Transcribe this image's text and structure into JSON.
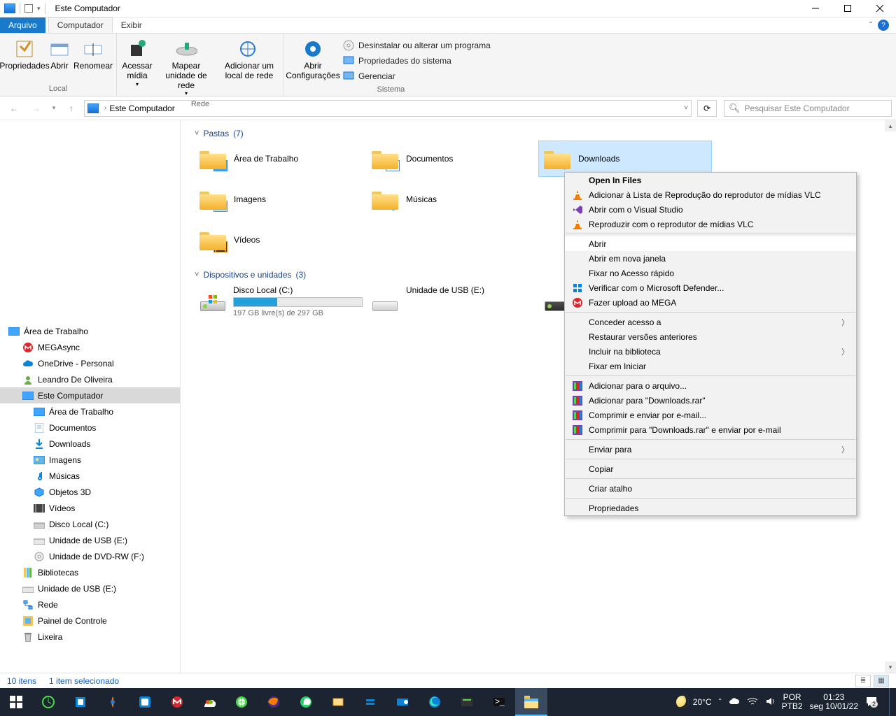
{
  "window": {
    "title": "Este Computador"
  },
  "ribbonTabs": {
    "file": "Arquivo",
    "computer": "Computador",
    "view": "Exibir"
  },
  "ribbon": {
    "local": {
      "label": "Local",
      "properties": "Propriedades",
      "open": "Abrir",
      "rename": "Renomear"
    },
    "network": {
      "label": "Rede",
      "accessMedia": "Acessar mídia",
      "mapDrive": "Mapear unidade de rede",
      "addLocation": "Adicionar um local de rede"
    },
    "system": {
      "label": "Sistema",
      "openSettings": "Abrir Configurações",
      "uninstall": "Desinstalar ou alterar um programa",
      "sysProps": "Propriedades do sistema",
      "manage": "Gerenciar"
    }
  },
  "addressbar": {
    "location": "Este Computador",
    "searchPlaceholder": "Pesquisar Este Computador"
  },
  "navTree": {
    "desktop": "Área de Trabalho",
    "megasync": "MEGAsync",
    "onedrive": "OneDrive - Personal",
    "user": "Leandro De Oliveira",
    "thisPc": "Este Computador",
    "pcDesktop": "Área de Trabalho",
    "documents": "Documentos",
    "downloads": "Downloads",
    "pictures": "Imagens",
    "music": "Músicas",
    "objects3d": "Objetos 3D",
    "videos": "Vídeos",
    "localDisk": "Disco Local (C:)",
    "usb": "Unidade de USB (E:)",
    "dvd": "Unidade de DVD-RW (F:)",
    "libraries": "Bibliotecas",
    "usb2": "Unidade de USB (E:)",
    "network": "Rede",
    "controlPanel": "Painel de Controle",
    "recycle": "Lixeira"
  },
  "content": {
    "foldersHeader": "Pastas",
    "foldersCount": "(7)",
    "drivesHeader": "Dispositivos e unidades",
    "drivesCount": "(3)",
    "folders": {
      "desktop": "Área de Trabalho",
      "documents": "Documentos",
      "downloads": "Downloads",
      "pictures": "Imagens",
      "music": "Músicas",
      "videos": "Vídeos"
    },
    "drives": {
      "c": {
        "name": "Disco Local (C:)",
        "sub": "197 GB livre(s) de 297 GB",
        "fillPct": 34
      },
      "usb": {
        "name": "Unidade de USB (E:)"
      }
    }
  },
  "contextMenu": {
    "openInFiles": "Open In Files",
    "vlcAdd": "Adicionar à Lista de Reprodução do reprodutor de mídias VLC",
    "openVS": "Abrir com o Visual Studio",
    "vlcPlay": "Reproduzir com o reprodutor de mídias VLC",
    "open": "Abrir",
    "openNew": "Abrir em nova janela",
    "pinQuick": "Fixar no Acesso rápido",
    "defender": "Verificar com o Microsoft Defender...",
    "mega": "Fazer upload ao MEGA",
    "grantAccess": "Conceder acesso a",
    "restore": "Restaurar versões anteriores",
    "library": "Incluir na biblioteca",
    "pinStart": "Fixar em Iniciar",
    "rarAdd": "Adicionar para o arquivo...",
    "rarAddName": "Adicionar para \"Downloads.rar\"",
    "rarEmail": "Comprimir e enviar por e-mail...",
    "rarEmailName": "Comprimir para \"Downloads.rar\" e enviar por e-mail",
    "sendTo": "Enviar para",
    "copy": "Copiar",
    "shortcut": "Criar atalho",
    "properties": "Propriedades"
  },
  "status": {
    "items": "10 itens",
    "selected": "1 item selecionado"
  },
  "taskbar": {
    "weather": "20°C",
    "lang1": "POR",
    "lang2": "PTB2",
    "time": "01:23",
    "date": "seg 10/01/22",
    "notifCount": "2"
  }
}
